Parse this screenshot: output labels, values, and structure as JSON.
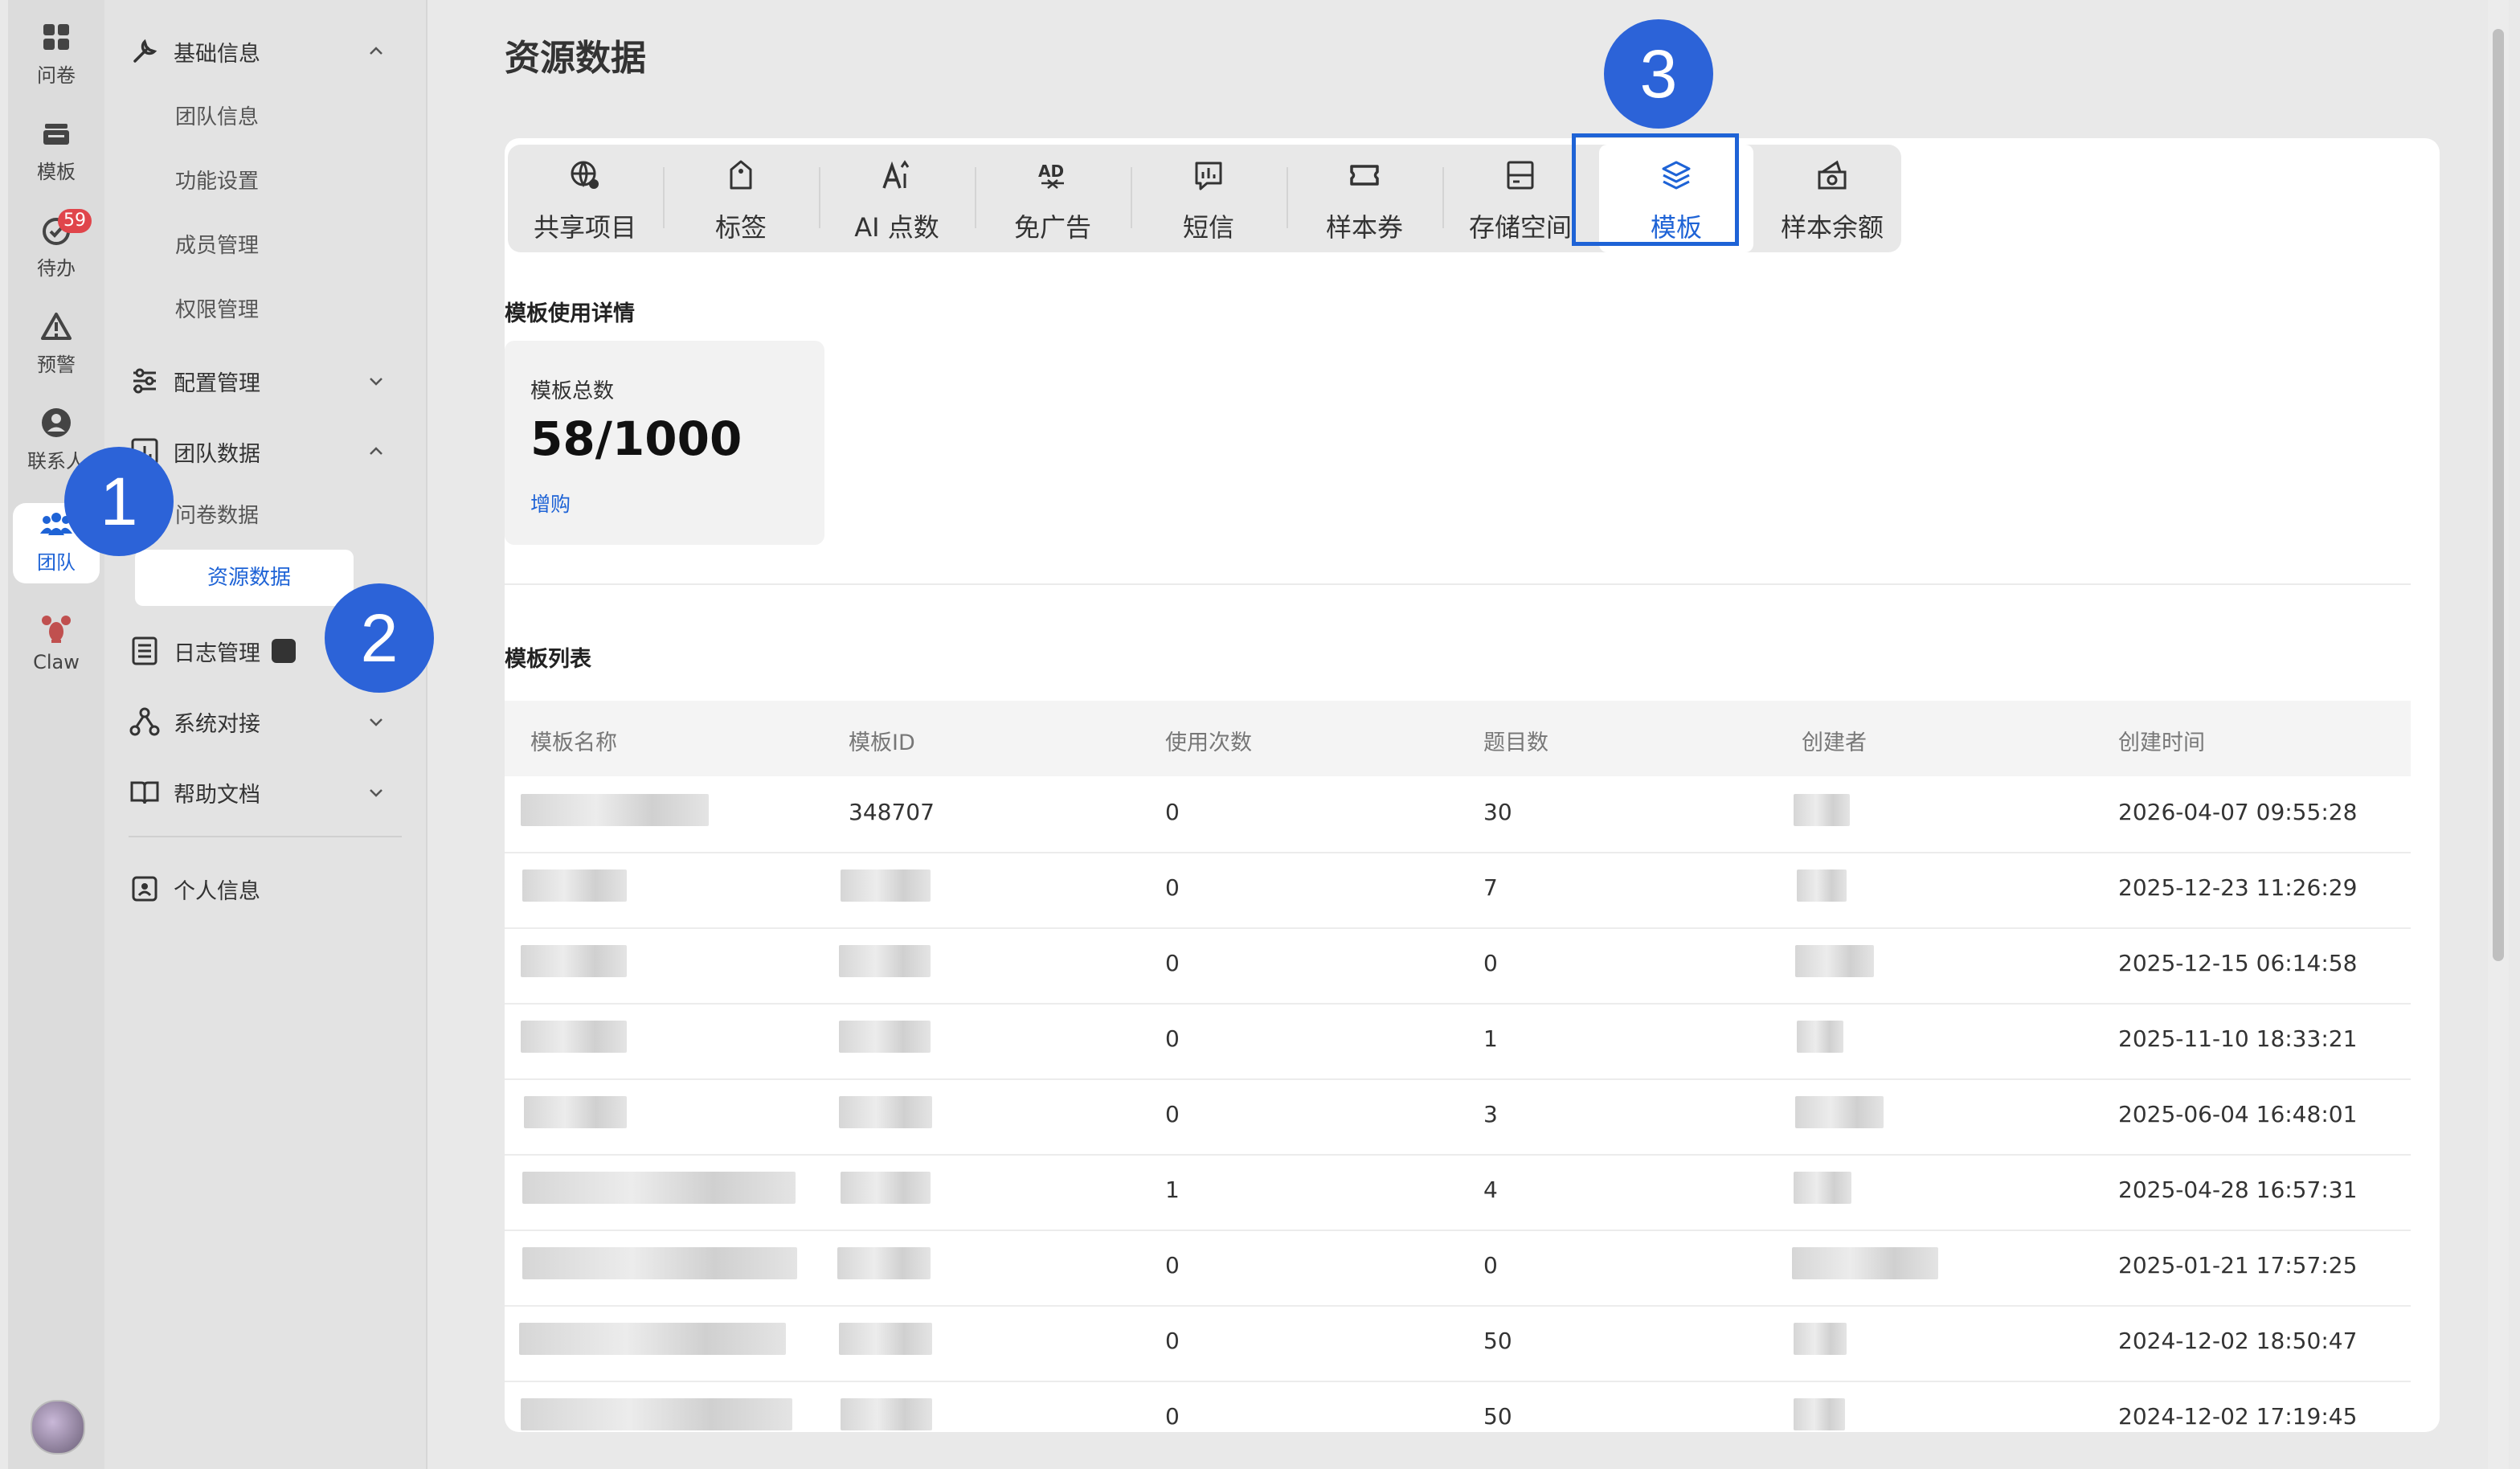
{
  "rail": {
    "items": [
      {
        "label": "问卷",
        "icon": "grid-icon"
      },
      {
        "label": "模板",
        "icon": "template-stack-icon"
      },
      {
        "label": "待办",
        "icon": "check-circle-icon",
        "badge": "59"
      },
      {
        "label": "预警",
        "icon": "warning-triangle-icon"
      },
      {
        "label": "联系人",
        "icon": "person-icon"
      },
      {
        "label": "团队",
        "icon": "team-icon"
      },
      {
        "label": "Claw",
        "icon": "lobster-icon"
      }
    ]
  },
  "nav": {
    "groups": [
      {
        "label": "基础信息"
      },
      {
        "label": "配置管理"
      },
      {
        "label": "团队数据"
      },
      {
        "label": "日志管理"
      },
      {
        "label": "系统对接"
      },
      {
        "label": "帮助文档"
      },
      {
        "label": "个人信息"
      }
    ],
    "basic_items": [
      "团队信息",
      "功能设置",
      "成员管理",
      "权限管理"
    ],
    "data_items": [
      "问卷数据",
      "资源数据"
    ]
  },
  "page": {
    "title": "资源数据"
  },
  "tabs": [
    {
      "label": "共享项目",
      "icon": "globe-share-icon"
    },
    {
      "label": "标签",
      "icon": "tag-icon"
    },
    {
      "label": "AI 点数",
      "icon": "ai-text-icon"
    },
    {
      "label": "免广告",
      "icon": "ad-free-icon"
    },
    {
      "label": "短信",
      "icon": "sms-chart-icon"
    },
    {
      "label": "样本券",
      "icon": "ticket-icon"
    },
    {
      "label": "存储空间",
      "icon": "storage-icon"
    },
    {
      "label": "模板",
      "icon": "layers-icon"
    },
    {
      "label": "样本余额",
      "icon": "wallet-icon"
    }
  ],
  "usage": {
    "section_title": "模板使用详情",
    "stat_label": "模板总数",
    "stat_value": "58/1000",
    "stat_action": "增购"
  },
  "list": {
    "section_title": "模板列表",
    "columns": [
      "模板名称",
      "模板ID",
      "使用次数",
      "题目数",
      "创建者",
      "创建时间"
    ],
    "rows": [
      {
        "id": "348707",
        "uses": "0",
        "questions": "30",
        "created": "2026-04-07 09:55:28"
      },
      {
        "id": "",
        "uses": "0",
        "questions": "7",
        "created": "2025-12-23 11:26:29"
      },
      {
        "id": "",
        "uses": "0",
        "questions": "0",
        "created": "2025-12-15 06:14:58"
      },
      {
        "id": "",
        "uses": "0",
        "questions": "1",
        "created": "2025-11-10 18:33:21"
      },
      {
        "id": "",
        "uses": "0",
        "questions": "3",
        "created": "2025-06-04 16:48:01"
      },
      {
        "id": "",
        "uses": "1",
        "questions": "4",
        "created": "2025-04-28 16:57:31"
      },
      {
        "id": "",
        "uses": "0",
        "questions": "0",
        "created": "2025-01-21 17:57:25"
      },
      {
        "id": "",
        "uses": "0",
        "questions": "50",
        "created": "2024-12-02 18:50:47"
      },
      {
        "id": "",
        "uses": "0",
        "questions": "50",
        "created": "2024-12-02 17:19:45"
      }
    ]
  },
  "callouts": [
    "1",
    "2",
    "3"
  ],
  "colors": {
    "accent": "#1e63d6",
    "callout": "#2c63d8",
    "badge": "#e0454b"
  }
}
